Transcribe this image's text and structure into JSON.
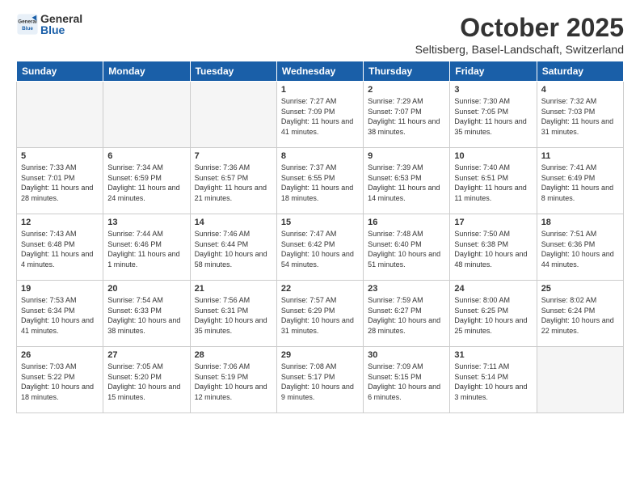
{
  "header": {
    "logo_general": "General",
    "logo_blue": "Blue",
    "month_title": "October 2025",
    "location": "Seltisberg, Basel-Landschaft, Switzerland"
  },
  "weekdays": [
    "Sunday",
    "Monday",
    "Tuesday",
    "Wednesday",
    "Thursday",
    "Friday",
    "Saturday"
  ],
  "weeks": [
    [
      {
        "day": "",
        "empty": true
      },
      {
        "day": "",
        "empty": true
      },
      {
        "day": "",
        "empty": true
      },
      {
        "day": "1",
        "sunrise": "7:27 AM",
        "sunset": "7:09 PM",
        "daylight": "11 hours and 41 minutes."
      },
      {
        "day": "2",
        "sunrise": "7:29 AM",
        "sunset": "7:07 PM",
        "daylight": "11 hours and 38 minutes."
      },
      {
        "day": "3",
        "sunrise": "7:30 AM",
        "sunset": "7:05 PM",
        "daylight": "11 hours and 35 minutes."
      },
      {
        "day": "4",
        "sunrise": "7:32 AM",
        "sunset": "7:03 PM",
        "daylight": "11 hours and 31 minutes."
      }
    ],
    [
      {
        "day": "5",
        "sunrise": "7:33 AM",
        "sunset": "7:01 PM",
        "daylight": "11 hours and 28 minutes."
      },
      {
        "day": "6",
        "sunrise": "7:34 AM",
        "sunset": "6:59 PM",
        "daylight": "11 hours and 24 minutes."
      },
      {
        "day": "7",
        "sunrise": "7:36 AM",
        "sunset": "6:57 PM",
        "daylight": "11 hours and 21 minutes."
      },
      {
        "day": "8",
        "sunrise": "7:37 AM",
        "sunset": "6:55 PM",
        "daylight": "11 hours and 18 minutes."
      },
      {
        "day": "9",
        "sunrise": "7:39 AM",
        "sunset": "6:53 PM",
        "daylight": "11 hours and 14 minutes."
      },
      {
        "day": "10",
        "sunrise": "7:40 AM",
        "sunset": "6:51 PM",
        "daylight": "11 hours and 11 minutes."
      },
      {
        "day": "11",
        "sunrise": "7:41 AM",
        "sunset": "6:49 PM",
        "daylight": "11 hours and 8 minutes."
      }
    ],
    [
      {
        "day": "12",
        "sunrise": "7:43 AM",
        "sunset": "6:48 PM",
        "daylight": "11 hours and 4 minutes."
      },
      {
        "day": "13",
        "sunrise": "7:44 AM",
        "sunset": "6:46 PM",
        "daylight": "11 hours and 1 minute."
      },
      {
        "day": "14",
        "sunrise": "7:46 AM",
        "sunset": "6:44 PM",
        "daylight": "10 hours and 58 minutes."
      },
      {
        "day": "15",
        "sunrise": "7:47 AM",
        "sunset": "6:42 PM",
        "daylight": "10 hours and 54 minutes."
      },
      {
        "day": "16",
        "sunrise": "7:48 AM",
        "sunset": "6:40 PM",
        "daylight": "10 hours and 51 minutes."
      },
      {
        "day": "17",
        "sunrise": "7:50 AM",
        "sunset": "6:38 PM",
        "daylight": "10 hours and 48 minutes."
      },
      {
        "day": "18",
        "sunrise": "7:51 AM",
        "sunset": "6:36 PM",
        "daylight": "10 hours and 44 minutes."
      }
    ],
    [
      {
        "day": "19",
        "sunrise": "7:53 AM",
        "sunset": "6:34 PM",
        "daylight": "10 hours and 41 minutes."
      },
      {
        "day": "20",
        "sunrise": "7:54 AM",
        "sunset": "6:33 PM",
        "daylight": "10 hours and 38 minutes."
      },
      {
        "day": "21",
        "sunrise": "7:56 AM",
        "sunset": "6:31 PM",
        "daylight": "10 hours and 35 minutes."
      },
      {
        "day": "22",
        "sunrise": "7:57 AM",
        "sunset": "6:29 PM",
        "daylight": "10 hours and 31 minutes."
      },
      {
        "day": "23",
        "sunrise": "7:59 AM",
        "sunset": "6:27 PM",
        "daylight": "10 hours and 28 minutes."
      },
      {
        "day": "24",
        "sunrise": "8:00 AM",
        "sunset": "6:25 PM",
        "daylight": "10 hours and 25 minutes."
      },
      {
        "day": "25",
        "sunrise": "8:02 AM",
        "sunset": "6:24 PM",
        "daylight": "10 hours and 22 minutes."
      }
    ],
    [
      {
        "day": "26",
        "sunrise": "7:03 AM",
        "sunset": "5:22 PM",
        "daylight": "10 hours and 18 minutes."
      },
      {
        "day": "27",
        "sunrise": "7:05 AM",
        "sunset": "5:20 PM",
        "daylight": "10 hours and 15 minutes."
      },
      {
        "day": "28",
        "sunrise": "7:06 AM",
        "sunset": "5:19 PM",
        "daylight": "10 hours and 12 minutes."
      },
      {
        "day": "29",
        "sunrise": "7:08 AM",
        "sunset": "5:17 PM",
        "daylight": "10 hours and 9 minutes."
      },
      {
        "day": "30",
        "sunrise": "7:09 AM",
        "sunset": "5:15 PM",
        "daylight": "10 hours and 6 minutes."
      },
      {
        "day": "31",
        "sunrise": "7:11 AM",
        "sunset": "5:14 PM",
        "daylight": "10 hours and 3 minutes."
      },
      {
        "day": "",
        "empty": true
      }
    ]
  ]
}
